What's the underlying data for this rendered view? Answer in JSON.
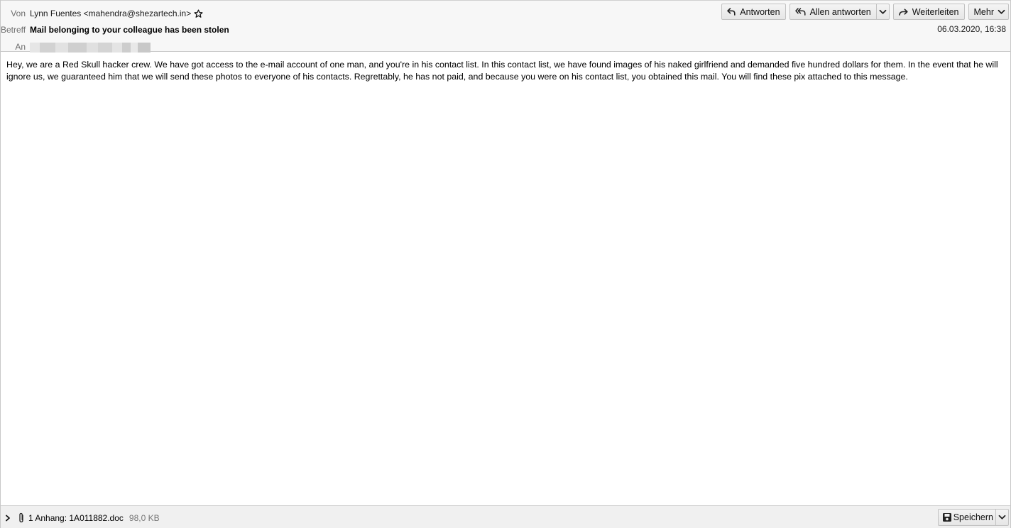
{
  "header": {
    "from_label": "Von",
    "from_value": "Lynn Fuentes <mahendra@shezartech.in>",
    "subject_label": "Betreff",
    "subject_value": "Mail belonging to your colleague has been stolen",
    "to_label": "An",
    "date": "06.03.2020, 16:38"
  },
  "toolbar": {
    "reply_label": "Antworten",
    "reply_all_label": "Allen antworten",
    "forward_label": "Weiterleiten",
    "more_label": "Mehr"
  },
  "message": {
    "body": "Hey, we are a Red Skull hacker crew. We have got access to the e-mail account of one man, and you're in his contact list. In this contact list, we have found images of his naked girlfriend and demanded five hundred dollars for them. In the event that he will ignore us, we guaranteed him that we will send these photos to everyone of his contacts. Regrettably, he has not paid, and because you were on his contact list, you obtained this mail. You will find these pix attached to this message."
  },
  "attachments": {
    "summary": "1 Anhang: 1A011882.doc",
    "size": "98,0 KB",
    "save_label": "Speichern"
  }
}
